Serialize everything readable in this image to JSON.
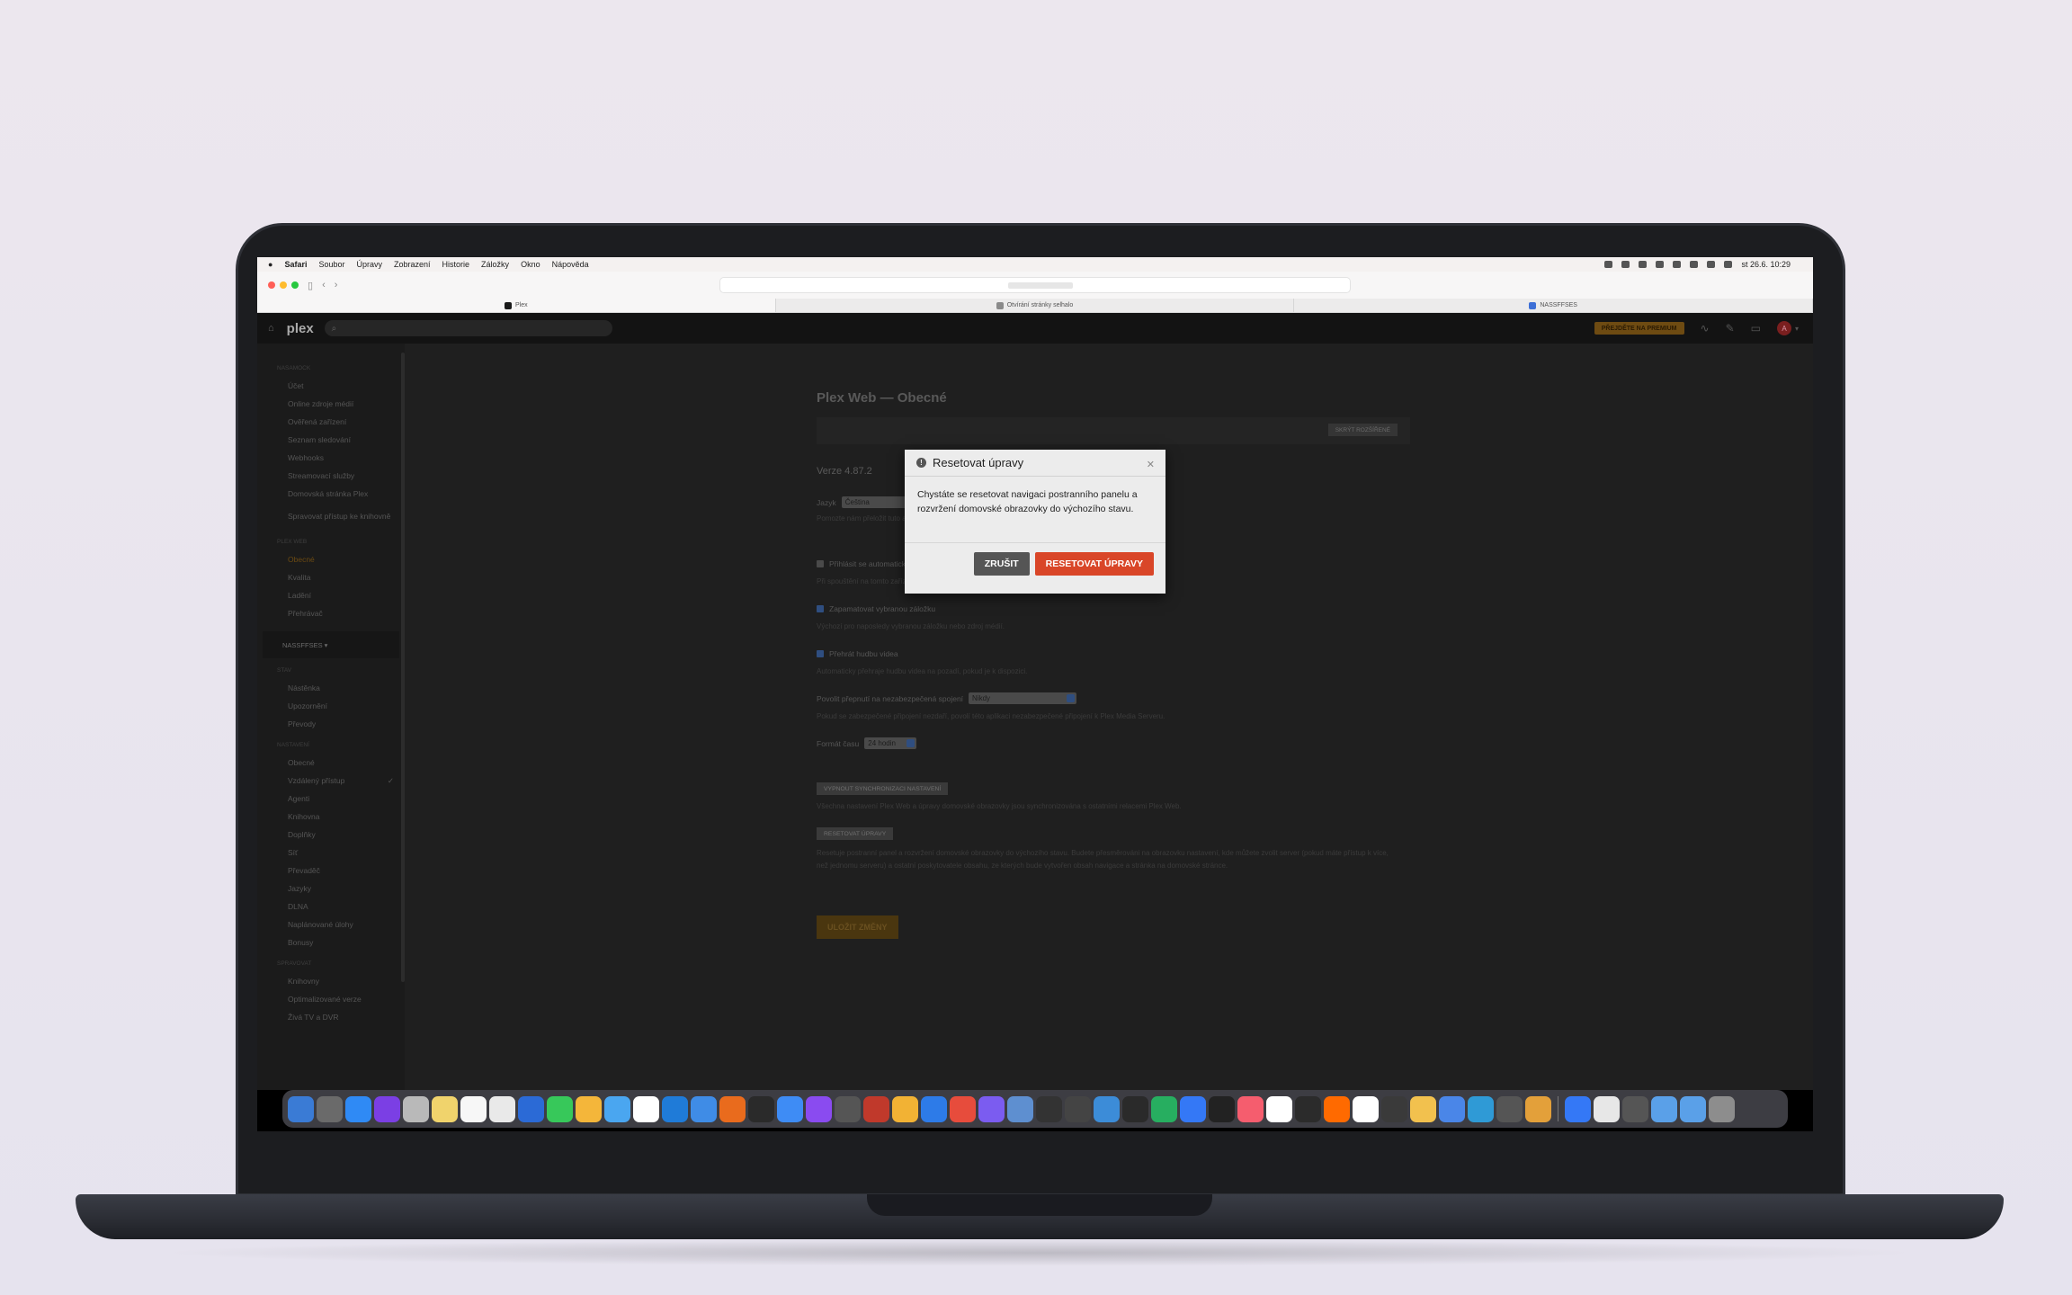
{
  "menubar": {
    "app": "Safari",
    "items": [
      "Soubor",
      "Úpravy",
      "Zobrazení",
      "Historie",
      "Záložky",
      "Okno",
      "Nápověda"
    ],
    "clock": "st 26.6. 10:29"
  },
  "tabs": [
    {
      "label": "Plex",
      "icon_color": "#1a1a1a"
    },
    {
      "label": "Otvírání stránky selhalo",
      "icon_color": "#8a8a8a"
    },
    {
      "label": "NASSFFSES",
      "icon_color": "#3d6fd6"
    }
  ],
  "plex": {
    "logo": "plex",
    "premium": "PŘEJDĚTE NA PREMIUM",
    "avatar": "A"
  },
  "sidebar": {
    "sections": [
      {
        "title": "NASAMOCK",
        "items": [
          "Účet",
          "Online zdroje médií",
          "Ověřená zařízení",
          "Seznam sledování",
          "Webhooks",
          "Streamovací služby",
          "Domovská stránka Plex",
          "Spravovat přístup ke knihovně"
        ]
      },
      {
        "title": "PLEX WEB",
        "items": [
          "Obecné",
          "Kvalita",
          "Ladění",
          "Přehrávač"
        ]
      },
      {
        "title": "STAV",
        "items": [
          "Nástěnka",
          "Upozornění",
          "Převody"
        ]
      },
      {
        "title": "NASTAVENÍ",
        "items": [
          "Obecné",
          "Vzdálený přístup",
          "Agenti",
          "Knihovna",
          "Doplňky",
          "Síť",
          "Převaděč",
          "Jazyky",
          "DLNA",
          "Naplánované úlohy",
          "Bonusy"
        ]
      },
      {
        "title": "SPRAVOVAT",
        "items": [
          "Knihovny",
          "Optimalizované verze",
          "Živá TV a DVR"
        ]
      }
    ],
    "server": "NASSFFSES ▾"
  },
  "content": {
    "title": "Plex Web — Obecné",
    "banner_btn": "SKRÝT ROZŠÍŘENÉ",
    "version": "Verze 4.87.2",
    "lang_label": "Jazyk",
    "lang_value": "Čeština",
    "lang_help": "Pomozte nám přeložit tuto aplikaci do vašeho jazyka zde.",
    "auto_login": "Přihlásit se automaticky",
    "auto_login_help": "Při spouštění na tomto zařízení se neptá na výběr uživatele nebo zadání PINu.",
    "remember_tab": "Zapamatovat vybranou záložku",
    "remember_tab_help": "Výchozí pro naposledy vybranou záložku nebo zdroj médií.",
    "play_music": "Přehrát hudbu videa",
    "play_music_help": "Automaticky přehraje hudbu videa na pozadí, pokud je k dispozici.",
    "insecure_label": "Povolit přepnutí na nezabezpečená spojení",
    "insecure_value": "Nikdy",
    "insecure_help": "Pokud se zabezpečené připojení nezdaří, povolí této aplikaci nezabezpečené připojení k Plex Media Serveru.",
    "time_label": "Formát času",
    "time_value": "24 hodin",
    "sync_btn": "VYPNOUT SYNCHRONIZACI NASTAVENÍ",
    "sync_help": "Všechna nastavení Plex Web a úpravy domovské obrazovky jsou synchronizována s ostatními relacemi Plex Web.",
    "reset_btn": "RESETOVAT ÚPRAVY",
    "reset_help": "Resetuje postranní panel a rozvržení domovské obrazovky do výchozího stavu. Budete přesměrováni na obrazovku nastavení, kde můžete zvolit server (pokud máte přístup k více, než jednomu serveru) a ostatní poskytovatele obsahu, ze kterých bude vytvořen obsah navigace a stránka na domovské stránce.",
    "save_btn": "ULOŽIT ZMĚNY"
  },
  "modal": {
    "title": "Resetovat úpravy",
    "body": "Chystáte se resetovat navigaci postranního panelu a rozvržení domovské obrazovky do výchozího stavu.",
    "cancel": "ZRUŠIT",
    "confirm": "RESETOVAT ÚPRAVY"
  },
  "dock_colors": [
    "#3a7bd5",
    "#6a6a6a",
    "#2f8af5",
    "#7b3fe4",
    "#b9b9b9",
    "#f0d36c",
    "#f7f7f7",
    "#e9e9e9",
    "#2b6ad6",
    "#37c85a",
    "#f4b63a",
    "#4aa6f0",
    "#ffffff",
    "#1f7bd8",
    "#3f8ce6",
    "#e96b1d",
    "#2a2a2a",
    "#3e8cf5",
    "#8a4bf0",
    "#555555",
    "#c0392b",
    "#f2b234",
    "#2d7be8",
    "#e74c3c",
    "#7b5cf0",
    "#5e8fd0",
    "#333333",
    "#444444",
    "#3c8cd8",
    "#2a2a2a",
    "#27ae60",
    "#3478f6",
    "#222222",
    "#f55d6e",
    "#ffffff",
    "#2b2b2b",
    "#ff6a00",
    "#ffffff",
    "#3a3a3a",
    "#f2c14e",
    "#4a86e8",
    "#2f9ad6",
    "#555555",
    "#e3a03a"
  ],
  "dock_tail_colors": [
    "#3478f6",
    "#e7e7e7",
    "#555555",
    "#5aa0e8",
    "#5aa0e8",
    "#8d8d8d"
  ]
}
